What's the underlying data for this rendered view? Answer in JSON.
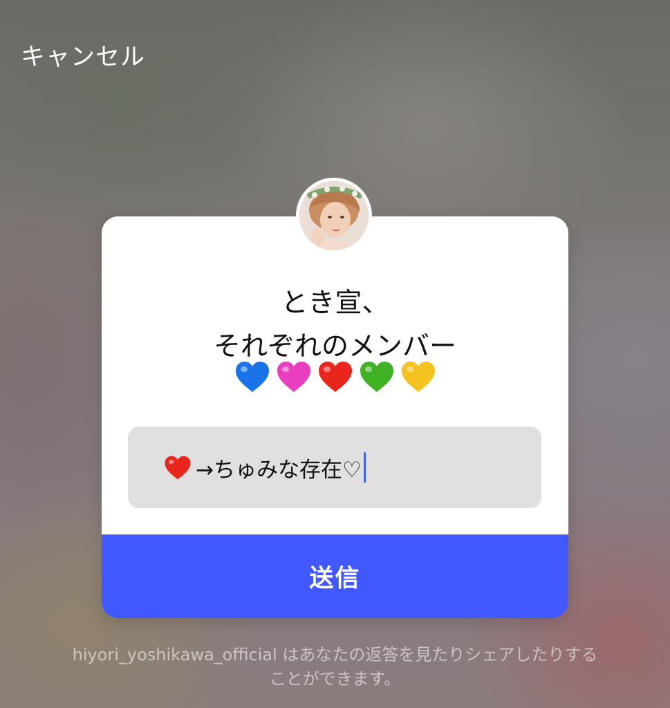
{
  "header": {
    "cancel_label": "キャンセル"
  },
  "card": {
    "question_line1": "とき宣、",
    "question_line2": "それぞれのメンバー",
    "question_emoji": [
      {
        "name": "blue-heart",
        "color": "#1a73e8"
      },
      {
        "name": "pink-heart",
        "color": "#e83ec0"
      },
      {
        "name": "red-heart",
        "color": "#e8261c"
      },
      {
        "name": "green-heart",
        "color": "#3fb324"
      },
      {
        "name": "yellow-heart",
        "color": "#f5c320"
      }
    ],
    "answer_prefix_icon": "red-heart",
    "answer_text": "→ちゅみな存在♡",
    "send_label": "送信"
  },
  "footer": {
    "line1": "hiyori_yoshikawa_official はあなたの返答を見たりシェアしたりする",
    "line2": "ことができます。"
  },
  "colors": {
    "accent": "#4158ff",
    "caret": "#3f5ef6",
    "input_bg": "#e0e0e0"
  }
}
